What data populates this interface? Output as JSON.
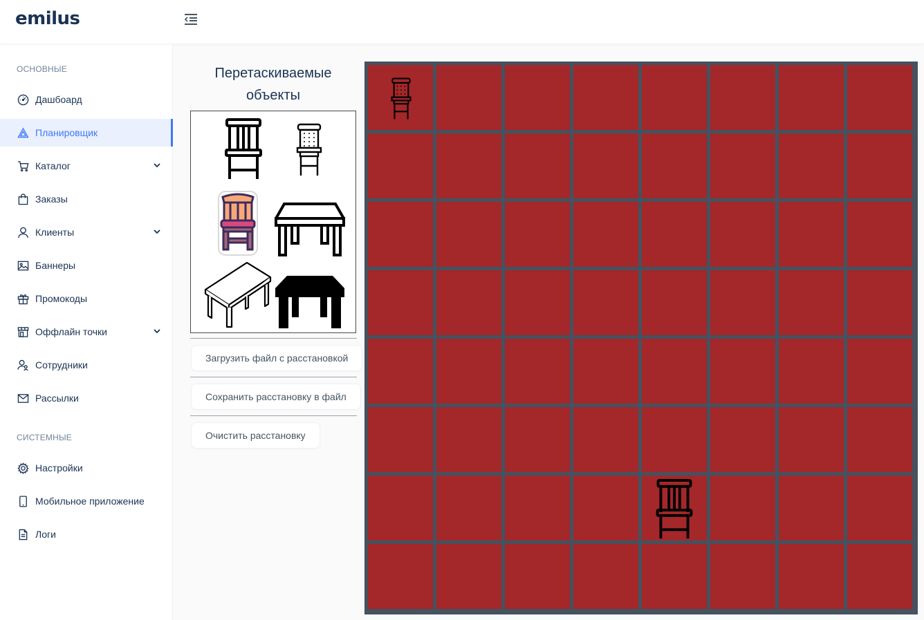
{
  "app": {
    "logo": "emilus"
  },
  "header": {
    "toggle_icon": "menu-fold-icon"
  },
  "sidebar": {
    "groups": [
      {
        "title": "ОСНОВНЫЕ"
      },
      {
        "title": "СИСТЕМНЫЕ"
      }
    ],
    "items": [
      {
        "label": "Дашбоард",
        "icon": "dashboard-icon",
        "active": false,
        "expandable": false
      },
      {
        "label": "Планировщик",
        "icon": "planner-icon",
        "active": true,
        "expandable": false
      },
      {
        "label": "Каталог",
        "icon": "cart-icon",
        "active": false,
        "expandable": true
      },
      {
        "label": "Заказы",
        "icon": "shopping-bag-icon",
        "active": false,
        "expandable": false
      },
      {
        "label": "Клиенты",
        "icon": "user-icon",
        "active": false,
        "expandable": true
      },
      {
        "label": "Баннеры",
        "icon": "image-icon",
        "active": false,
        "expandable": false
      },
      {
        "label": "Промокоды",
        "icon": "gift-icon",
        "active": false,
        "expandable": false
      },
      {
        "label": "Оффлайн точки",
        "icon": "shop-icon",
        "active": false,
        "expandable": true
      },
      {
        "label": "Сотрудники",
        "icon": "team-icon",
        "active": false,
        "expandable": false
      },
      {
        "label": "Рассылки",
        "icon": "mail-icon",
        "active": false,
        "expandable": false
      },
      {
        "label": "Настройки",
        "icon": "setting-icon",
        "active": false,
        "expandable": false
      },
      {
        "label": "Мобильное приложение",
        "icon": "mobile-icon",
        "active": false,
        "expandable": false
      },
      {
        "label": "Логи",
        "icon": "file-text-icon",
        "active": false,
        "expandable": false
      }
    ]
  },
  "planner": {
    "title": "Перетаскиваемые объекты",
    "objects": [
      {
        "name": "wooden-chair-icon"
      },
      {
        "name": "perforated-chair-icon"
      },
      {
        "name": "colored-chair-icon"
      },
      {
        "name": "outline-table-icon"
      },
      {
        "name": "perspective-table-icon"
      },
      {
        "name": "solid-table-icon"
      }
    ],
    "buttons": {
      "load": "Загрузить файл с расстановкой",
      "save": "Сохранить расстановку в файл",
      "clear": "Очистить расстановку"
    },
    "grid": {
      "rows": 8,
      "cols": 8,
      "cell_color": "#a4272a",
      "line_color": "#45525f",
      "placed": [
        {
          "object": "perforated-chair-icon",
          "row": 0,
          "col": 0
        },
        {
          "object": "wooden-chair-icon",
          "row": 6,
          "col": 4
        }
      ]
    }
  },
  "colors": {
    "accent": "#3e79f7",
    "text": "#1a3353",
    "muted": "#72849a"
  }
}
